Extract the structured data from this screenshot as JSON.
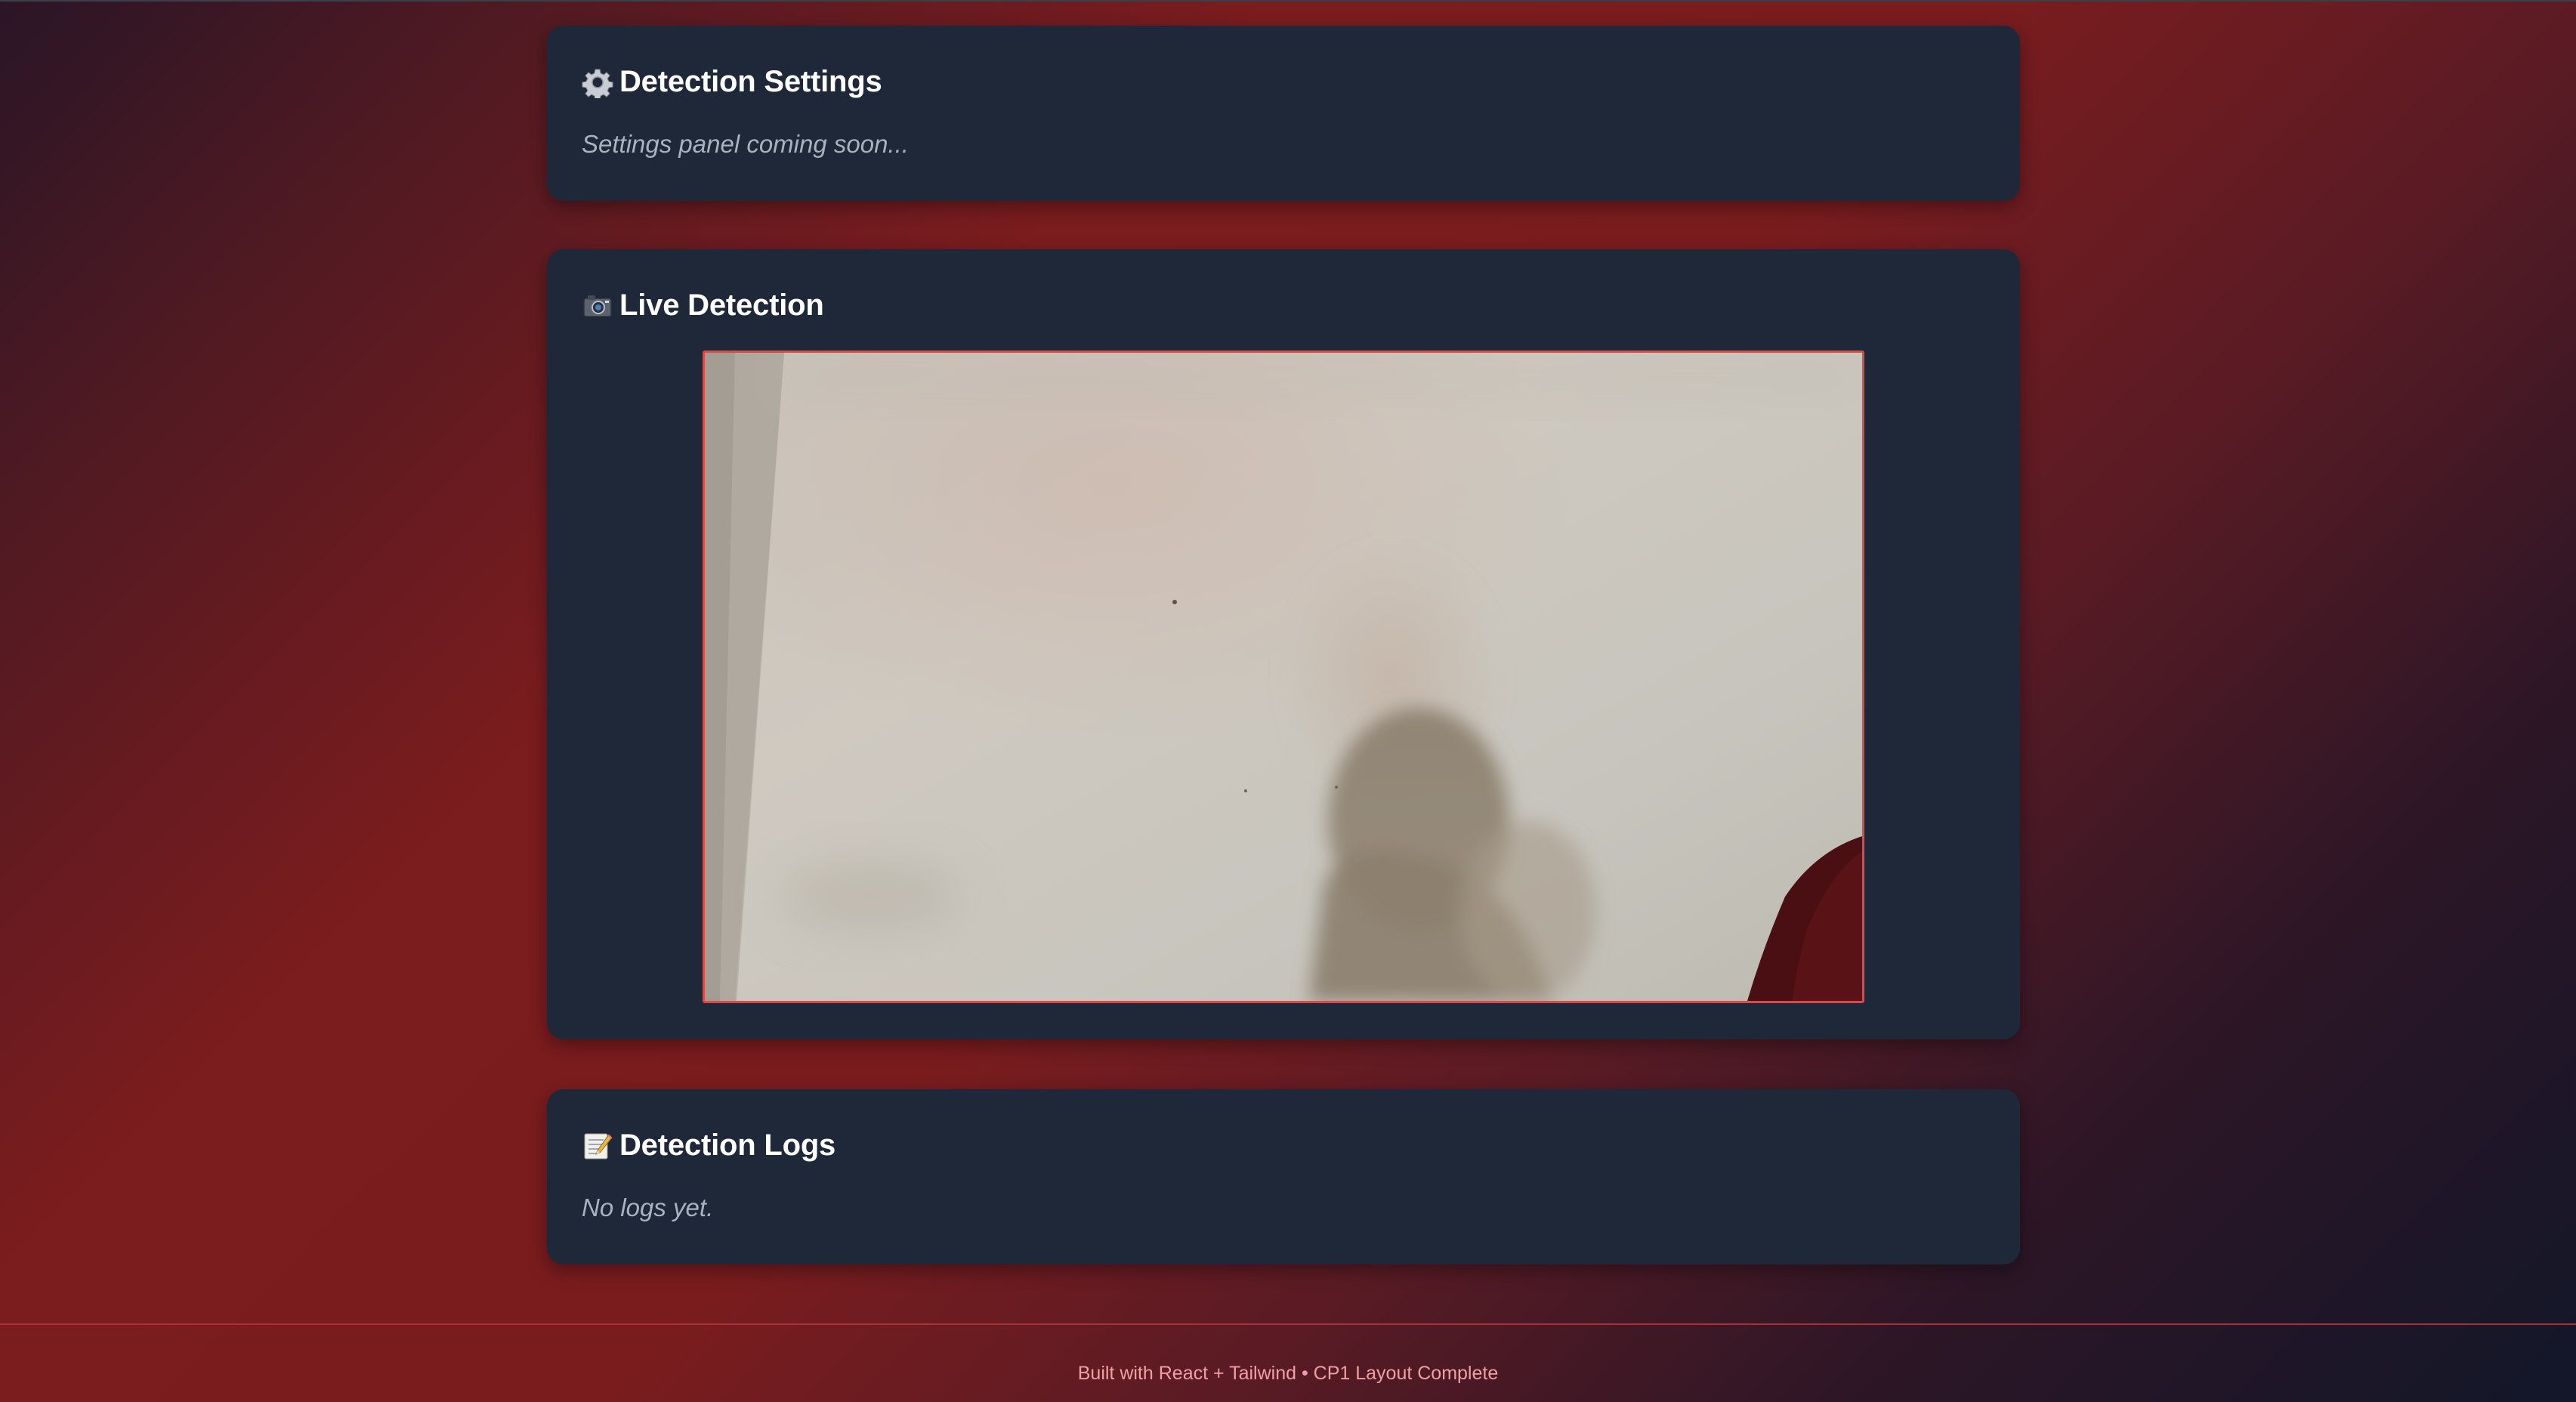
{
  "settings_panel": {
    "title": "Detection Settings",
    "icon": "gear-icon",
    "message": "Settings panel coming soon..."
  },
  "live_panel": {
    "title": "Live Detection",
    "icon": "camera-icon"
  },
  "logs_panel": {
    "title": "Detection Logs",
    "icon": "memo-icon",
    "message": "No logs yet."
  },
  "footer": {
    "text": "Built with React + Tailwind • CP1 Layout Complete"
  },
  "colors": {
    "panel_bg": "#1f2839",
    "video_border": "#d94a4a",
    "accent_red": "#7b1c1e",
    "footer_text": "#f0a0a4"
  }
}
